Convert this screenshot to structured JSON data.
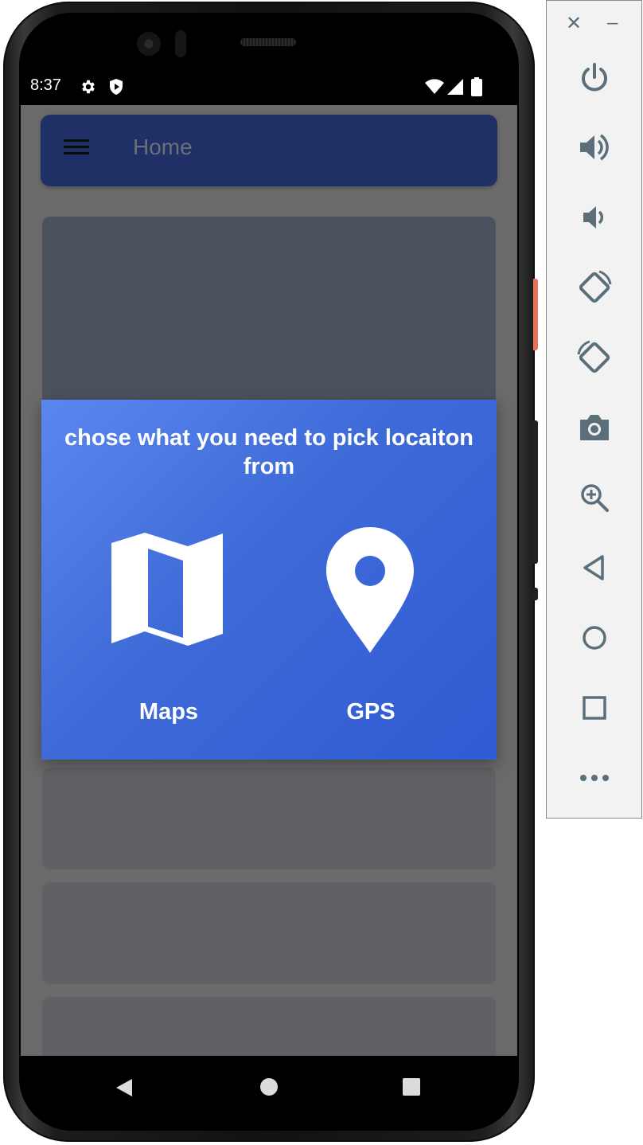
{
  "status_bar": {
    "time": "8:37",
    "icons": [
      "gear-icon",
      "shield-play-icon",
      "wifi-icon",
      "signal-icon",
      "battery-icon"
    ]
  },
  "app_bar": {
    "title": "Home",
    "menu_icon": "hamburger-menu-icon",
    "background": "#1f3066"
  },
  "dialog": {
    "title": "chose what you need to pick locaiton from",
    "gradient": [
      "#5a87ef",
      "#2f5bd3"
    ],
    "options": [
      {
        "label": "Maps",
        "icon": "map-icon"
      },
      {
        "label": "GPS",
        "icon": "location-pin-icon"
      }
    ]
  },
  "nav_bar": {
    "buttons": [
      "back-icon",
      "home-icon",
      "recents-icon"
    ]
  },
  "emulator_panel": {
    "window_controls": [
      "close-icon",
      "minimize-icon"
    ],
    "controls": [
      "power-icon",
      "volume-up-icon",
      "volume-down-icon",
      "rotate-left-icon",
      "rotate-right-icon",
      "camera-icon",
      "zoom-icon",
      "back-icon",
      "home-icon",
      "overview-icon",
      "more-icon"
    ],
    "icon_color": "#5b6f7a"
  }
}
